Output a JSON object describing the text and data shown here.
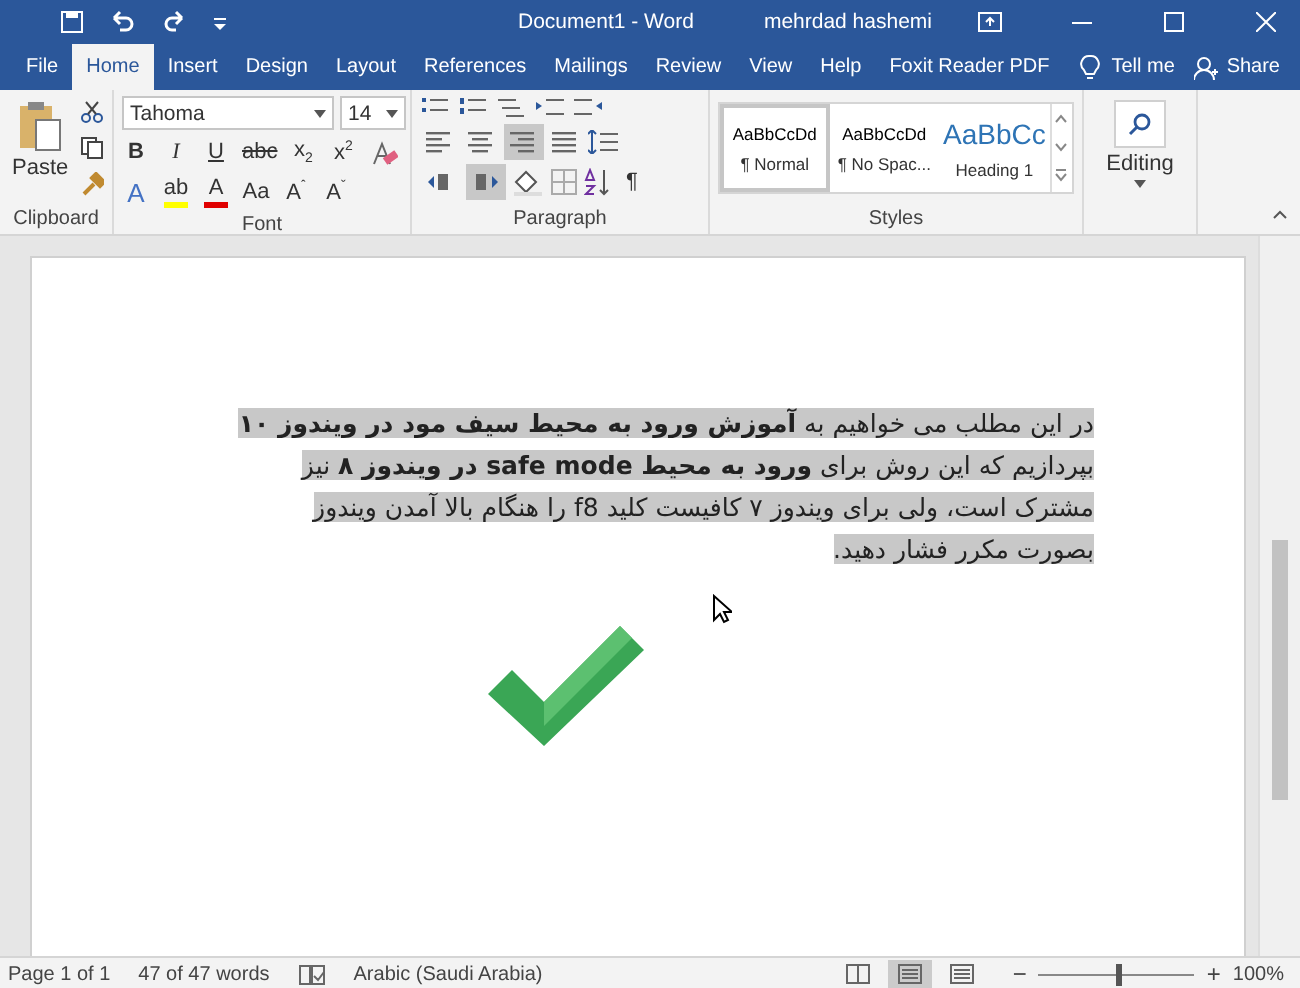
{
  "window": {
    "title": "Document1  -  Word",
    "user": "mehrdad hashemi"
  },
  "tabs": [
    {
      "label": "File",
      "selected": false
    },
    {
      "label": "Home",
      "selected": true
    },
    {
      "label": "Insert",
      "selected": false
    },
    {
      "label": "Design",
      "selected": false
    },
    {
      "label": "Layout",
      "selected": false
    },
    {
      "label": "References",
      "selected": false
    },
    {
      "label": "Mailings",
      "selected": false
    },
    {
      "label": "Review",
      "selected": false
    },
    {
      "label": "View",
      "selected": false
    },
    {
      "label": "Help",
      "selected": false
    },
    {
      "label": "Foxit Reader PDF",
      "selected": false
    }
  ],
  "tell_me": "Tell me",
  "share": "Share",
  "clipboard": {
    "paste": "Paste",
    "label": "Clipboard"
  },
  "font": {
    "name": "Tahoma",
    "size": "14",
    "label": "Font",
    "row1": [
      {
        "kind": "bold",
        "text": "B"
      },
      {
        "kind": "italic",
        "text": "I"
      },
      {
        "kind": "underline",
        "text": "U"
      },
      {
        "kind": "strike",
        "text": "abc"
      },
      {
        "kind": "plain",
        "text": "x$_{2}$"
      },
      {
        "kind": "plain",
        "text": "x$^{2}$"
      }
    ],
    "row2": [
      {
        "kind": "effects",
        "text": "A"
      },
      {
        "kind": "highlight",
        "text": "ab",
        "color": "#ffff00"
      },
      {
        "kind": "fontcolor",
        "text": "A",
        "color": "#e00000"
      },
      {
        "kind": "plain",
        "text": "Aa"
      },
      {
        "kind": "plain",
        "text": "A$^{ˆ}$"
      },
      {
        "kind": "plain",
        "text": "A$^{ˇ}$"
      }
    ]
  },
  "paragraph": {
    "label": "Paragraph",
    "alignment": [
      {
        "selected": false
      },
      {
        "selected": false
      },
      {
        "selected": true
      },
      {
        "selected": false
      }
    ],
    "direction": [
      {
        "selected": false
      },
      {
        "selected": true
      }
    ],
    "marks": "¶"
  },
  "styles": {
    "label": "Styles",
    "items": [
      {
        "sample": "AaBbCcDd",
        "name": "¶ Normal",
        "kind": "body",
        "selected": true
      },
      {
        "sample": "AaBbCcDd",
        "name": "¶ No Spac...",
        "kind": "body",
        "selected": false
      },
      {
        "sample": "AaBbCc",
        "name": "Heading 1",
        "kind": "heading",
        "selected": false
      }
    ]
  },
  "editing": {
    "label": "Editing"
  },
  "document": {
    "paragraph": "در این مطلب می خواهیم به **آموزش ورود به محیط سیف مود در ویندوز ۱۰** بپردازیم که این روش برای **ورود به محیط safe mode در ویندوز ۸** نیز مشترک است، ولی برای ویندوز ۷ کافیست کلید f8 را هنگام بالا آمدن ویندوز بصورت مکرر فشار دهید.",
    "selected": true
  },
  "status_bar": {
    "page": "Page 1 of 1",
    "words": "47 of 47 words",
    "language": "Arabic (Saudi Arabia)",
    "views": [
      {
        "selected": false
      },
      {
        "selected": true
      },
      {
        "selected": false
      }
    ],
    "zoom_out": "−",
    "zoom_in": "+",
    "zoom": {
      "level": 0.5
    },
    "zoom_text": "100%"
  }
}
